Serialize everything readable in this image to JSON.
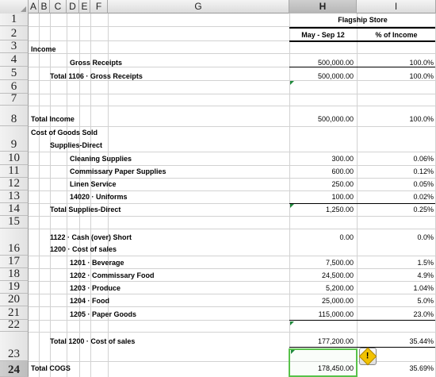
{
  "columns": [
    "A",
    "B",
    "C",
    "D",
    "E",
    "F",
    "G",
    "H",
    "I"
  ],
  "selected_column": "H",
  "rows": [
    "1",
    "2",
    "3",
    "4",
    "5",
    "6",
    "7",
    "8",
    "9",
    "10",
    "11",
    "12",
    "13",
    "14",
    "15",
    "16",
    "17",
    "18",
    "19",
    "20",
    "21",
    "22",
    "23",
    "24"
  ],
  "header": {
    "store": "Flagship Store",
    "period": "May - Sep 12",
    "pct": "% of Income"
  },
  "labels": {
    "income": "Income",
    "gross_receipts": "Gross Receipts",
    "total_1106": "Total 1106 · Gross Receipts",
    "total_income": "Total Income",
    "cogs": "Cost of Goods Sold",
    "supplies_direct": "Supplies-Direct",
    "cleaning": "Cleaning Supplies",
    "comm_paper": "Commissary Paper Supplies",
    "linen": "Linen Service",
    "uniforms": "14020 · Uniforms",
    "total_supplies": "Total Supplies-Direct",
    "cash_short": "1122 · Cash (over) Short",
    "cost_of_sales": "1200 · Cost of sales",
    "beverage": "1201 · Beverage",
    "comm_food": "1202 · Commissary Food",
    "produce": "1203 · Produce",
    "food": "1204 · Food",
    "paper_goods": "1205 · Paper Goods",
    "total_1200": "Total 1200 · Cost of sales",
    "total_cogs": "Total COGS"
  },
  "values": {
    "gross_receipts": "500,000.00",
    "total_1106": "500,000.00",
    "total_income": "500,000.00",
    "cleaning": "300.00",
    "comm_paper": "600.00",
    "linen": "250.00",
    "uniforms": "100.00",
    "total_supplies": "1,250.00",
    "cash_short": "0.00",
    "beverage": "7,500.00",
    "comm_food": "24,500.00",
    "produce": "5,200.00",
    "food": "25,000.00",
    "paper_goods": "115,000.00",
    "total_1200": "177,200.00",
    "total_cogs": "178,450.00"
  },
  "percents": {
    "gross_receipts": "100.0%",
    "total_1106": "100.0%",
    "total_income": "100.0%",
    "cleaning": "0.06%",
    "comm_paper": "0.12%",
    "linen": "0.05%",
    "uniforms": "0.02%",
    "total_supplies": "0.25%",
    "cash_short": "0.0%",
    "beverage": "1.5%",
    "comm_food": "4.9%",
    "produce": "1.04%",
    "food": "5.0%",
    "paper_goods": "23.0%",
    "total_1200": "35.44%",
    "total_cogs": "35.69%"
  },
  "warning_icon": "warning-diamond-icon",
  "warning_glyph": "!",
  "colors": {
    "selection": "#58c24a",
    "error_triangle": "#1f8a3c",
    "warning": "#f2c200"
  }
}
